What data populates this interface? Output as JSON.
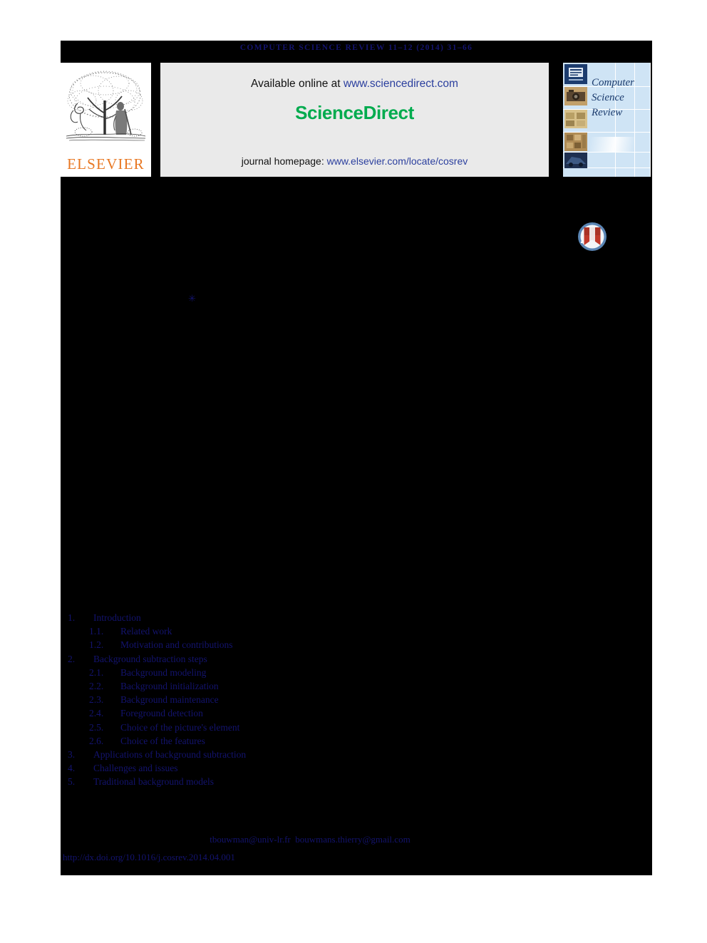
{
  "running_head": "COMPUTER SCIENCE REVIEW 11–12 (2014) 31–66",
  "masthead": {
    "publisher_name": "ELSEVIER",
    "publisher_logo_alt": "elsevier-tree-logo",
    "available_online_prefix": "Available online at ",
    "available_online_link": "www.sciencedirect.com",
    "sciencedirect_wordmark": "ScienceDirect",
    "journal_homepage_prefix": "journal homepage: ",
    "journal_homepage_link": "www.elsevier.com/locate/cosrev",
    "cover": {
      "title_line1": "Computer",
      "title_line2": "Science",
      "title_line3": "Review"
    }
  },
  "crossmark": {
    "label": "crossmark-badge"
  },
  "footnote": {
    "mark": "✳"
  },
  "toc": {
    "items": [
      {
        "number": "1.",
        "label": "Introduction",
        "level": 1
      },
      {
        "number": "1.1.",
        "label": "Related work",
        "level": 2
      },
      {
        "number": "1.2.",
        "label": "Motivation and contributions",
        "level": 2
      },
      {
        "number": "2.",
        "label": "Background subtraction steps",
        "level": 1
      },
      {
        "number": "2.1.",
        "label": "Background modeling",
        "level": 2
      },
      {
        "number": "2.2.",
        "label": "Background initialization",
        "level": 2
      },
      {
        "number": "2.3.",
        "label": "Background maintenance",
        "level": 2
      },
      {
        "number": "2.4.",
        "label": "Foreground detection",
        "level": 2
      },
      {
        "number": "2.5.",
        "label": "Choice of the picture's element",
        "level": 2
      },
      {
        "number": "2.6.",
        "label": "Choice of the features",
        "level": 2
      },
      {
        "number": "3.",
        "label": "Applications of background subtraction",
        "level": 1
      },
      {
        "number": "4.",
        "label": "Challenges and issues",
        "level": 1
      },
      {
        "number": "5.",
        "label": "Traditional background models",
        "level": 1
      }
    ]
  },
  "footer": {
    "email_primary": "tbouwman@univ-lr.fr",
    "email_secondary": "bouwmans.thierry@gmail.com",
    "doi_url": "http://dx.doi.org/10.1016/j.cosrev.2014.04.001"
  },
  "colors": {
    "page_background": "#000000",
    "paper_margin": "#ffffff",
    "link_navy": "#13136e",
    "sciencedirect_green": "#00AB4E",
    "banner_grey": "#eaeaea",
    "elsevier_orange": "#E87722",
    "cover_blue": "#cfe4f5",
    "cover_navy": "#1c3c6e",
    "sd_link_blue": "#2b3f9e"
  }
}
